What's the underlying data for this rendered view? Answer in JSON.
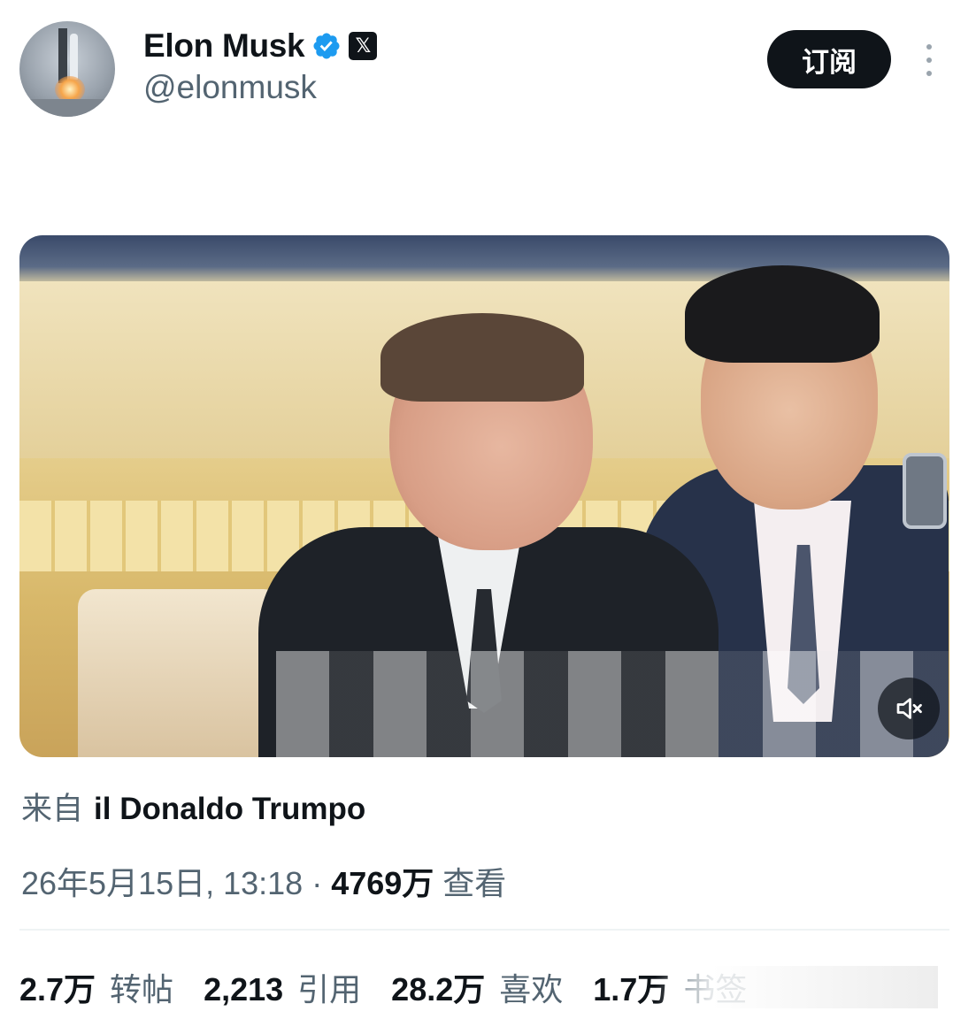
{
  "author": {
    "display_name": "Elon Musk",
    "handle": "@elonmusk",
    "verified": true,
    "verified_color": "#1d9bf0",
    "affiliation_badge": "𝕏"
  },
  "header": {
    "subscribe_label": "订阅",
    "more_icon": "more-vertical-icon"
  },
  "media": {
    "type": "video",
    "mute_icon": "speaker-muted-icon"
  },
  "source": {
    "prefix": "来自",
    "name": "il Donaldo Trumpo"
  },
  "meta": {
    "timestamp": "26年5月15日, 13:18",
    "separator": "·",
    "views_count": "4769万",
    "views_label": "查看"
  },
  "stats": [
    {
      "value": "2.7万",
      "label": "转帖"
    },
    {
      "value": "2,213",
      "label": "引用"
    },
    {
      "value": "28.2万",
      "label": "喜欢"
    },
    {
      "value": "1.7万",
      "label": "书签"
    }
  ],
  "colors": {
    "text_primary": "#0f1419",
    "text_secondary": "#536471",
    "divider": "#eff3f4",
    "button_bg": "#0f1419"
  }
}
